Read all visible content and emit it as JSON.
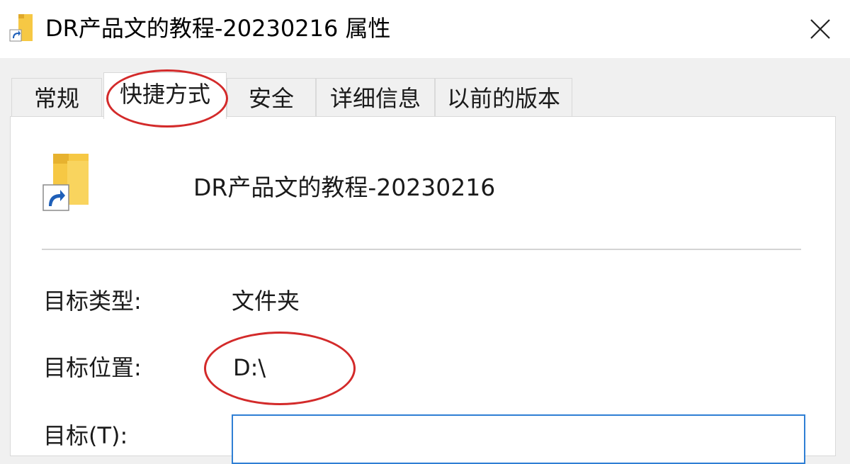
{
  "window": {
    "title": "DR产品文的教程-20230216 属性",
    "close_glyph": "✕"
  },
  "tabs": [
    {
      "label": "常规",
      "active": false
    },
    {
      "label": "快捷方式",
      "active": true
    },
    {
      "label": "安全",
      "active": false
    },
    {
      "label": "详细信息",
      "active": false
    },
    {
      "label": "以前的版本",
      "active": false
    }
  ],
  "shortcut": {
    "name": "DR产品文的教程-20230216",
    "icon": "folder-shortcut-icon",
    "rows": [
      {
        "label": "目标类型:",
        "value": "文件夹"
      },
      {
        "label": "目标位置:",
        "value": "D:\\"
      },
      {
        "label": "目标(T):",
        "value": ""
      }
    ]
  },
  "colors": {
    "accent_input_border": "#2f7fd4",
    "annotation_red": "#d32a2a",
    "folder_yellow": "#f6c844"
  }
}
